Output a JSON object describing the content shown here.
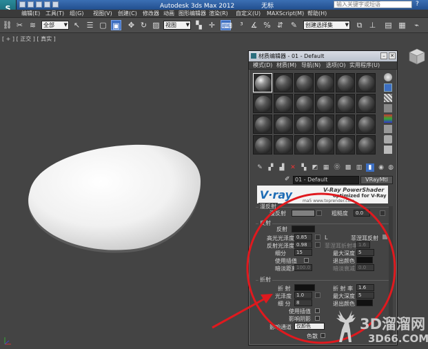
{
  "titlebar": {
    "logo": "S",
    "app_title": "Autodesk 3ds Max  2012",
    "file_tail": "无标",
    "search_placeholder": "输入关键字或短语",
    "help": "?"
  },
  "menubar": {
    "items": [
      "编辑(E)",
      "工具(T)",
      "组(G)",
      "视图(V)",
      "创建(C)",
      "修改器",
      "动画",
      "图形编辑器",
      "渲染(R)",
      "自定义(U)",
      "MAXScript(M)",
      "帮助(H)"
    ]
  },
  "toolbar": {
    "selection_filter": "全部",
    "reference_coord": "视图",
    "named_selection": "创建选择集"
  },
  "viewport": {
    "label": "[ + ] [ 正交 ] [ 真实 ]"
  },
  "material_editor": {
    "title": "材质编辑器 - 01 - Default",
    "menu": [
      "模式(D)",
      "材质(M)",
      "导航(N)",
      "选项(O)",
      "实用程序(U)"
    ],
    "material_name": "01 - Default",
    "material_type": "VRayMtl",
    "banner": {
      "logo": "V·ray",
      "line1": "V-Ray PowerShader",
      "line2": "optimized for V-Ray",
      "line3": "ma5 www.toprender.com"
    },
    "diffuse_group": {
      "title": "漫反射",
      "diffuse_label": "漫反射",
      "roughness_label": "粗糙度",
      "roughness_value": "0.0"
    },
    "reflection_group": {
      "title": "反射",
      "reflect_label": "反射",
      "hilight_gloss_label": "高光光泽度",
      "hilight_gloss_value": "0.85",
      "lock_label": "L",
      "fresnel_label": "菲涅耳反射",
      "refl_gloss_label": "反射光泽度",
      "refl_gloss_value": "0.98",
      "fresnel_ior_label": "菲涅耳折射率",
      "fresnel_ior_value": "1.6",
      "subdivs_label": "细分",
      "subdivs_value": "15",
      "max_depth_label": "最大深度",
      "max_depth_value": "5",
      "use_interp_label": "使用插值",
      "exit_color_label": "退出颜色",
      "dim_dist_label": "暗淡距离",
      "dim_dist_value": "100.0",
      "dim_falloff_label": "暗淡衰减",
      "dim_falloff_value": "0.0"
    },
    "refraction_group": {
      "title": "折射",
      "refract_label": "折 射",
      "ior_label": "折 射 率",
      "ior_value": "1.6",
      "gloss_label": "光泽度",
      "gloss_value": "1.0",
      "max_depth_label": "最大深度",
      "max_depth_value": "5",
      "subdivs_label": "细 分",
      "subdivs_value": "8",
      "exit_color_label": "退出颜色",
      "use_interp_label": "使用插值",
      "affect_shadows_label": "影响阴影",
      "affect_channels_label": "影响通道",
      "affect_channels_value": "仅颜色",
      "dispersion_label": "色散"
    }
  },
  "watermark": {
    "big": "3D溜溜网",
    "small": "3D66.COM"
  },
  "colors": {
    "viewport_bg": "#444444",
    "title_blue": "#2f5f9f",
    "highlight_circle": "#e0191e",
    "slot_selected_border": "#ffffff"
  }
}
